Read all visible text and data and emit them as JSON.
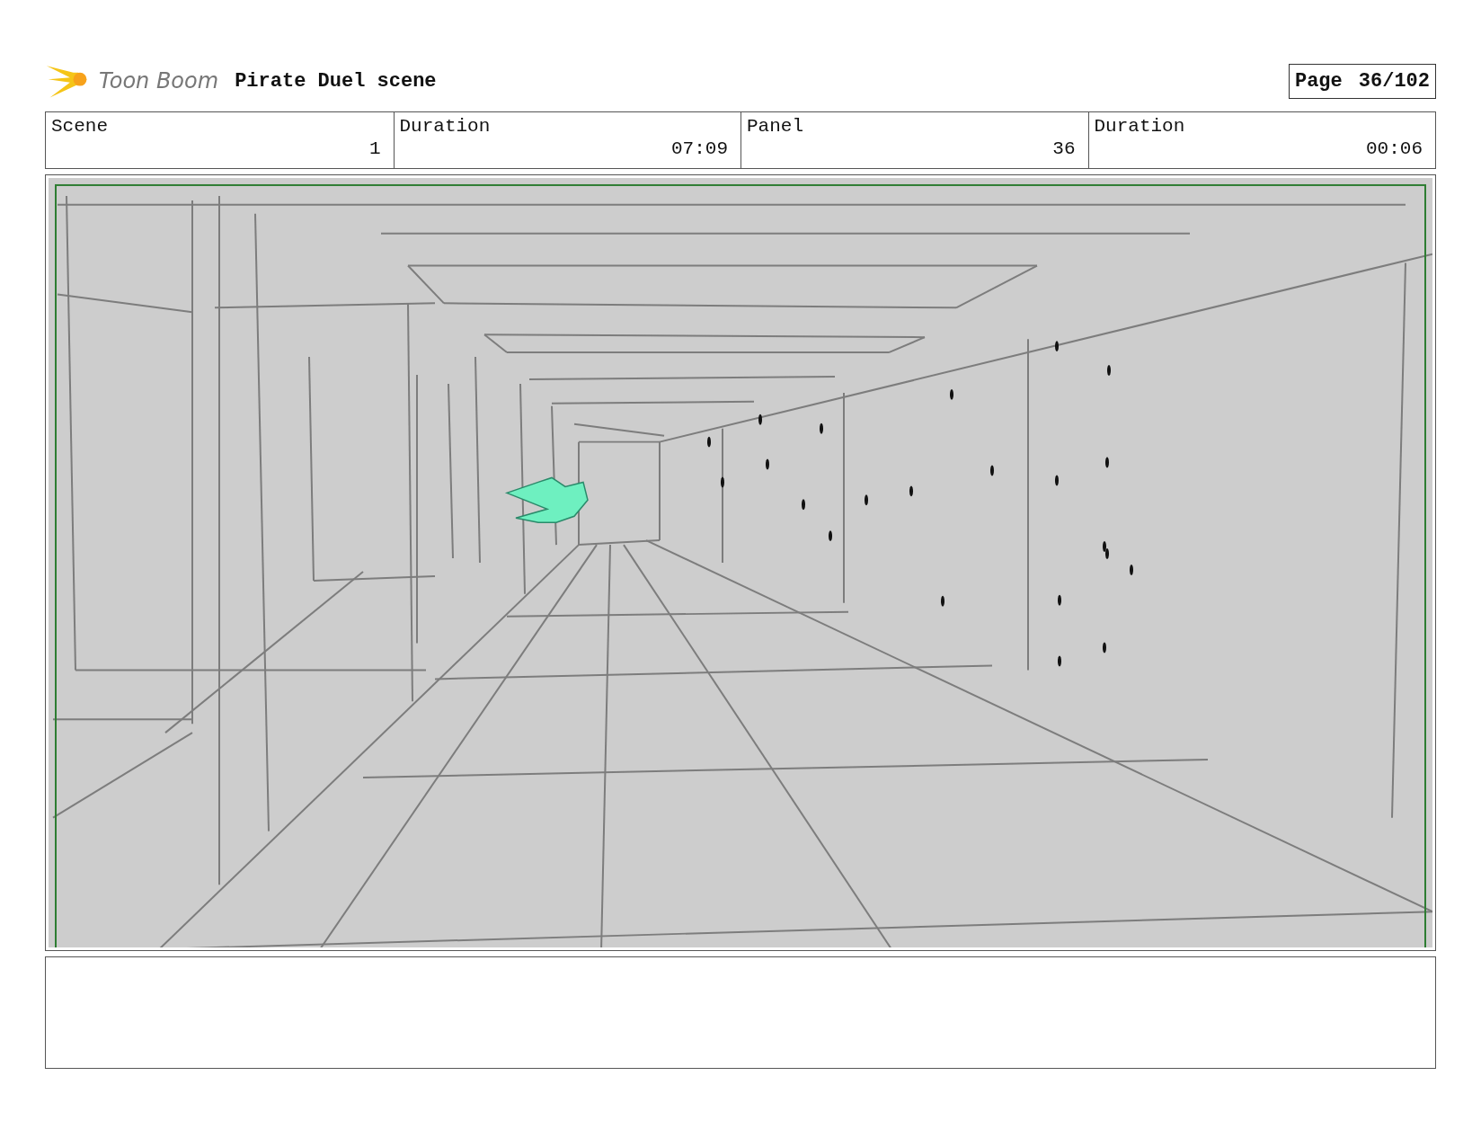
{
  "header": {
    "logo": "Toon Boom",
    "title": "Pirate Duel scene",
    "page_label": "Page",
    "page": "36/102"
  },
  "info": [
    {
      "label": "Scene",
      "value": "1"
    },
    {
      "label": "Duration",
      "value": "07:09"
    },
    {
      "label": "Panel",
      "value": "36"
    },
    {
      "label": "Duration",
      "value": "00:06"
    }
  ]
}
